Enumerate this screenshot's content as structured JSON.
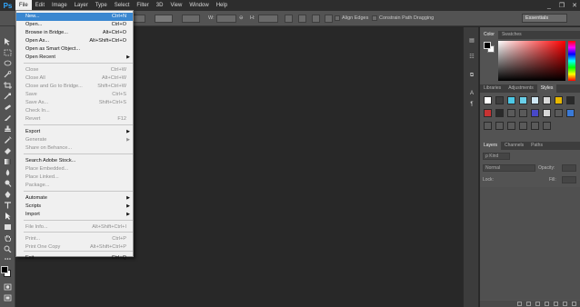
{
  "app": {
    "logo": "Ps",
    "accent": "#31a8ff"
  },
  "menubar": {
    "items": [
      "File",
      "Edit",
      "Image",
      "Layer",
      "Type",
      "Select",
      "Filter",
      "3D",
      "View",
      "Window",
      "Help"
    ],
    "active": "File"
  },
  "window_controls": {
    "minimize": "_",
    "restore": "❐",
    "close": "✕"
  },
  "options_bar": {
    "w_label": "W:",
    "link_symbol": "⊖",
    "h_label": "H:",
    "align_edges": "Align Edges",
    "constrain_path": "Constrain Path Dragging",
    "workspace": "Essentials"
  },
  "file_menu": {
    "items": [
      {
        "label": "New...",
        "shortcut": "Ctrl+N",
        "enabled": true,
        "highlighted": true
      },
      {
        "label": "Open...",
        "shortcut": "Ctrl+O",
        "enabled": true
      },
      {
        "label": "Browse in Bridge...",
        "shortcut": "Alt+Ctrl+O",
        "enabled": true
      },
      {
        "label": "Open As...",
        "shortcut": "Alt+Shift+Ctrl+O",
        "enabled": true
      },
      {
        "label": "Open as Smart Object...",
        "shortcut": "",
        "enabled": true
      },
      {
        "label": "Open Recent",
        "shortcut": "",
        "enabled": true,
        "submenu": true
      },
      {
        "label": "Close",
        "shortcut": "Ctrl+W",
        "enabled": false
      },
      {
        "label": "Close All",
        "shortcut": "Alt+Ctrl+W",
        "enabled": false
      },
      {
        "label": "Close and Go to Bridge...",
        "shortcut": "Shift+Ctrl+W",
        "enabled": false
      },
      {
        "label": "Save",
        "shortcut": "Ctrl+S",
        "enabled": false
      },
      {
        "label": "Save As...",
        "shortcut": "Shift+Ctrl+S",
        "enabled": false
      },
      {
        "label": "Check In...",
        "shortcut": "",
        "enabled": false
      },
      {
        "label": "Revert",
        "shortcut": "F12",
        "enabled": false
      },
      {
        "label": "Export",
        "shortcut": "",
        "enabled": true,
        "submenu": true
      },
      {
        "label": "Generate",
        "shortcut": "",
        "enabled": false,
        "submenu": true
      },
      {
        "label": "Share on Behance...",
        "shortcut": "",
        "enabled": false
      },
      {
        "label": "Search Adobe Stock...",
        "shortcut": "",
        "enabled": true
      },
      {
        "label": "Place Embedded...",
        "shortcut": "",
        "enabled": false
      },
      {
        "label": "Place Linked...",
        "shortcut": "",
        "enabled": false
      },
      {
        "label": "Package...",
        "shortcut": "",
        "enabled": false
      },
      {
        "label": "Automate",
        "shortcut": "",
        "enabled": true,
        "submenu": true
      },
      {
        "label": "Scripts",
        "shortcut": "",
        "enabled": true,
        "submenu": true
      },
      {
        "label": "Import",
        "shortcut": "",
        "enabled": true,
        "submenu": true
      },
      {
        "label": "File Info...",
        "shortcut": "Alt+Shift+Ctrl+I",
        "enabled": false
      },
      {
        "label": "Print...",
        "shortcut": "Ctrl+P",
        "enabled": false
      },
      {
        "label": "Print One Copy",
        "shortcut": "Alt+Shift+Ctrl+P",
        "enabled": false
      },
      {
        "label": "Exit",
        "shortcut": "Ctrl+Q",
        "enabled": true
      }
    ],
    "submenu_arrow": "▶"
  },
  "color_panel": {
    "tabs": [
      "Color",
      "Swatches"
    ],
    "foreground": "#000000",
    "background": "#ffffff",
    "hue": "#ff0000"
  },
  "styles_panel": {
    "tabs": [
      "Libraries",
      "Adjustments",
      "Styles"
    ],
    "swatch_colors": [
      "#ffffff",
      "#3d3d3d",
      "#4cc8e6",
      "#6ad0ea",
      "#cfe7f4",
      "#d9d9d9",
      "#e8b800",
      "#2a2a2a",
      "#c83232",
      "#2a2a2a",
      "#5a5a5a",
      "#5a5a5a",
      "#4848c8",
      "#d8d8d8",
      "#5a5a5a",
      "#3a7ad8",
      "#5a5a5a",
      "#5a5a5a",
      "#5a5a5a",
      "#5a5a5a",
      "#5a5a5a",
      "#5a5a5a"
    ]
  },
  "layers_panel": {
    "tabs": [
      "Layers",
      "Channels",
      "Paths"
    ],
    "filter": "ρ Kind",
    "blend_mode": "Normal",
    "opacity_label": "Opacity:",
    "lock_label": "Lock:",
    "fill_label": "Fill:"
  }
}
